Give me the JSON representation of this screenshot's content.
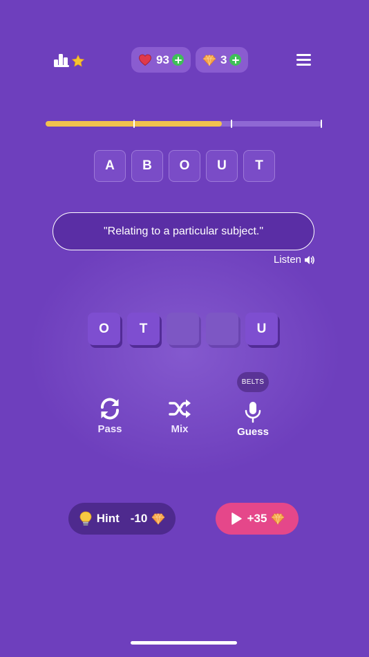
{
  "colors": {
    "background": "#6e3fbd",
    "progress_fill": "#f2c14e",
    "hint_button": "#4e2a8e",
    "video_button": "#e5478a",
    "plus_green": "#3fbf58"
  },
  "header": {
    "leaderboard_icon": "leaderboard-star-icon",
    "lives": {
      "icon": "heart-icon",
      "value": "93"
    },
    "gems": {
      "icon": "gem-icon",
      "value": "3"
    },
    "menu_icon": "hamburger-menu-icon"
  },
  "progress": {
    "fraction": 0.64,
    "ticks": [
      0.32,
      0.675,
      1.0
    ]
  },
  "target_word": [
    "A",
    "B",
    "O",
    "U",
    "T"
  ],
  "clue": {
    "text": "\"Relating to a particular subject.\""
  },
  "listen": {
    "label": "Listen",
    "icon": "speaker-icon"
  },
  "answer_tiles": [
    "O",
    "T",
    "",
    "",
    "U"
  ],
  "badge": "BELTS",
  "actions": {
    "pass": {
      "label": "Pass",
      "icon": "refresh-icon"
    },
    "mix": {
      "label": "Mix",
      "icon": "shuffle-icon"
    },
    "guess": {
      "label": "Guess",
      "icon": "microphone-icon"
    }
  },
  "hint_button": {
    "label": "Hint",
    "cost": "-10",
    "icon": "lightbulb-icon"
  },
  "video_button": {
    "label": "+35",
    "icon": "play-icon"
  }
}
